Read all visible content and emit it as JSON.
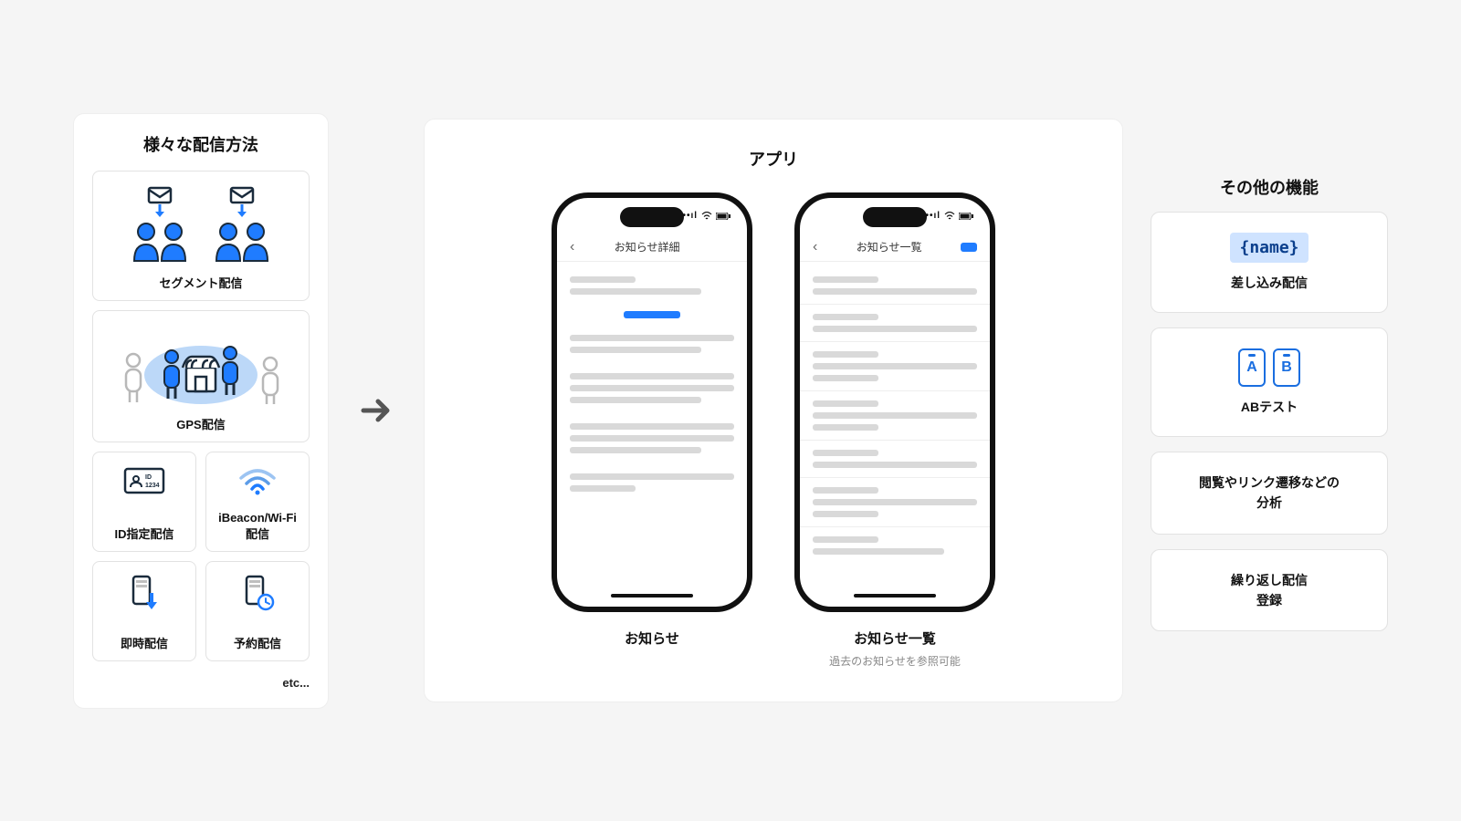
{
  "left": {
    "title": "様々な配信方法",
    "cards": {
      "segment": "セグメント配信",
      "gps": "GPS配信",
      "id": "ID指定配信",
      "ibeacon": "iBeacon/Wi-Fi配信",
      "instant": "即時配信",
      "scheduled": "予約配信"
    },
    "etc": "etc..."
  },
  "center": {
    "title": "アプリ",
    "phones": [
      {
        "nav_title": "お知らせ詳細",
        "label": "お知らせ",
        "sub": ""
      },
      {
        "nav_title": "お知らせ一覧",
        "label": "お知らせ一覧",
        "sub": "過去のお知らせを参照可能"
      }
    ]
  },
  "right": {
    "title": "その他の機能",
    "features": {
      "merge_tag": "{name}",
      "merge_label": "差し込み配信",
      "ab_a": "A",
      "ab_b": "B",
      "ab_label": "ABテスト",
      "analytics_line1": "閲覧やリンク遷移などの",
      "analytics_line2": "分析",
      "repeat_line1": "繰り返し配信",
      "repeat_line2": "登録"
    }
  },
  "colors": {
    "brand": "#1f7cff",
    "outline": "#1a2b3c",
    "muted": "#cfcfcf"
  }
}
